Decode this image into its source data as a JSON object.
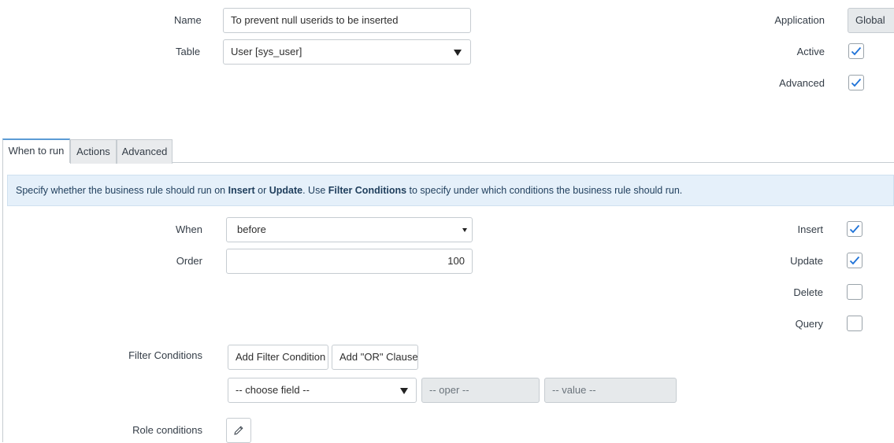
{
  "top_form": {
    "name_label": "Name",
    "name_value": "To prevent null userids to be inserted",
    "table_label": "Table",
    "table_value": "User [sys_user]",
    "application_label": "Application",
    "application_value": "Global",
    "active_label": "Active",
    "active_checked": true,
    "advanced_label": "Advanced",
    "advanced_checked": true
  },
  "tabs": [
    {
      "label": "When to run",
      "active": true
    },
    {
      "label": "Actions",
      "active": false
    },
    {
      "label": "Advanced",
      "active": false
    }
  ],
  "banner": {
    "part1": "Specify whether the business rule should run on ",
    "insert": "Insert",
    "or": " or ",
    "update": "Update",
    "part2": ". Use ",
    "filter": "Filter Conditions",
    "part3": " to specify under which conditions the business rule should run."
  },
  "when_form": {
    "when_label": "When",
    "when_value": "before",
    "order_label": "Order",
    "order_value": "100",
    "insert_label": "Insert",
    "insert_checked": true,
    "update_label": "Update",
    "update_checked": true,
    "delete_label": "Delete",
    "delete_checked": false,
    "query_label": "Query",
    "query_checked": false,
    "filter_label": "Filter Conditions",
    "add_filter_label": "Add Filter Condition",
    "add_or_label": "Add \"OR\" Clause",
    "choose_field": "-- choose field --",
    "oper": "-- oper --",
    "value": "-- value --",
    "role_label": "Role conditions"
  },
  "colors": {
    "check": "#1f73d8",
    "tab_active_border": "#5b9bd5",
    "banner_bg": "#e5f0fa"
  }
}
